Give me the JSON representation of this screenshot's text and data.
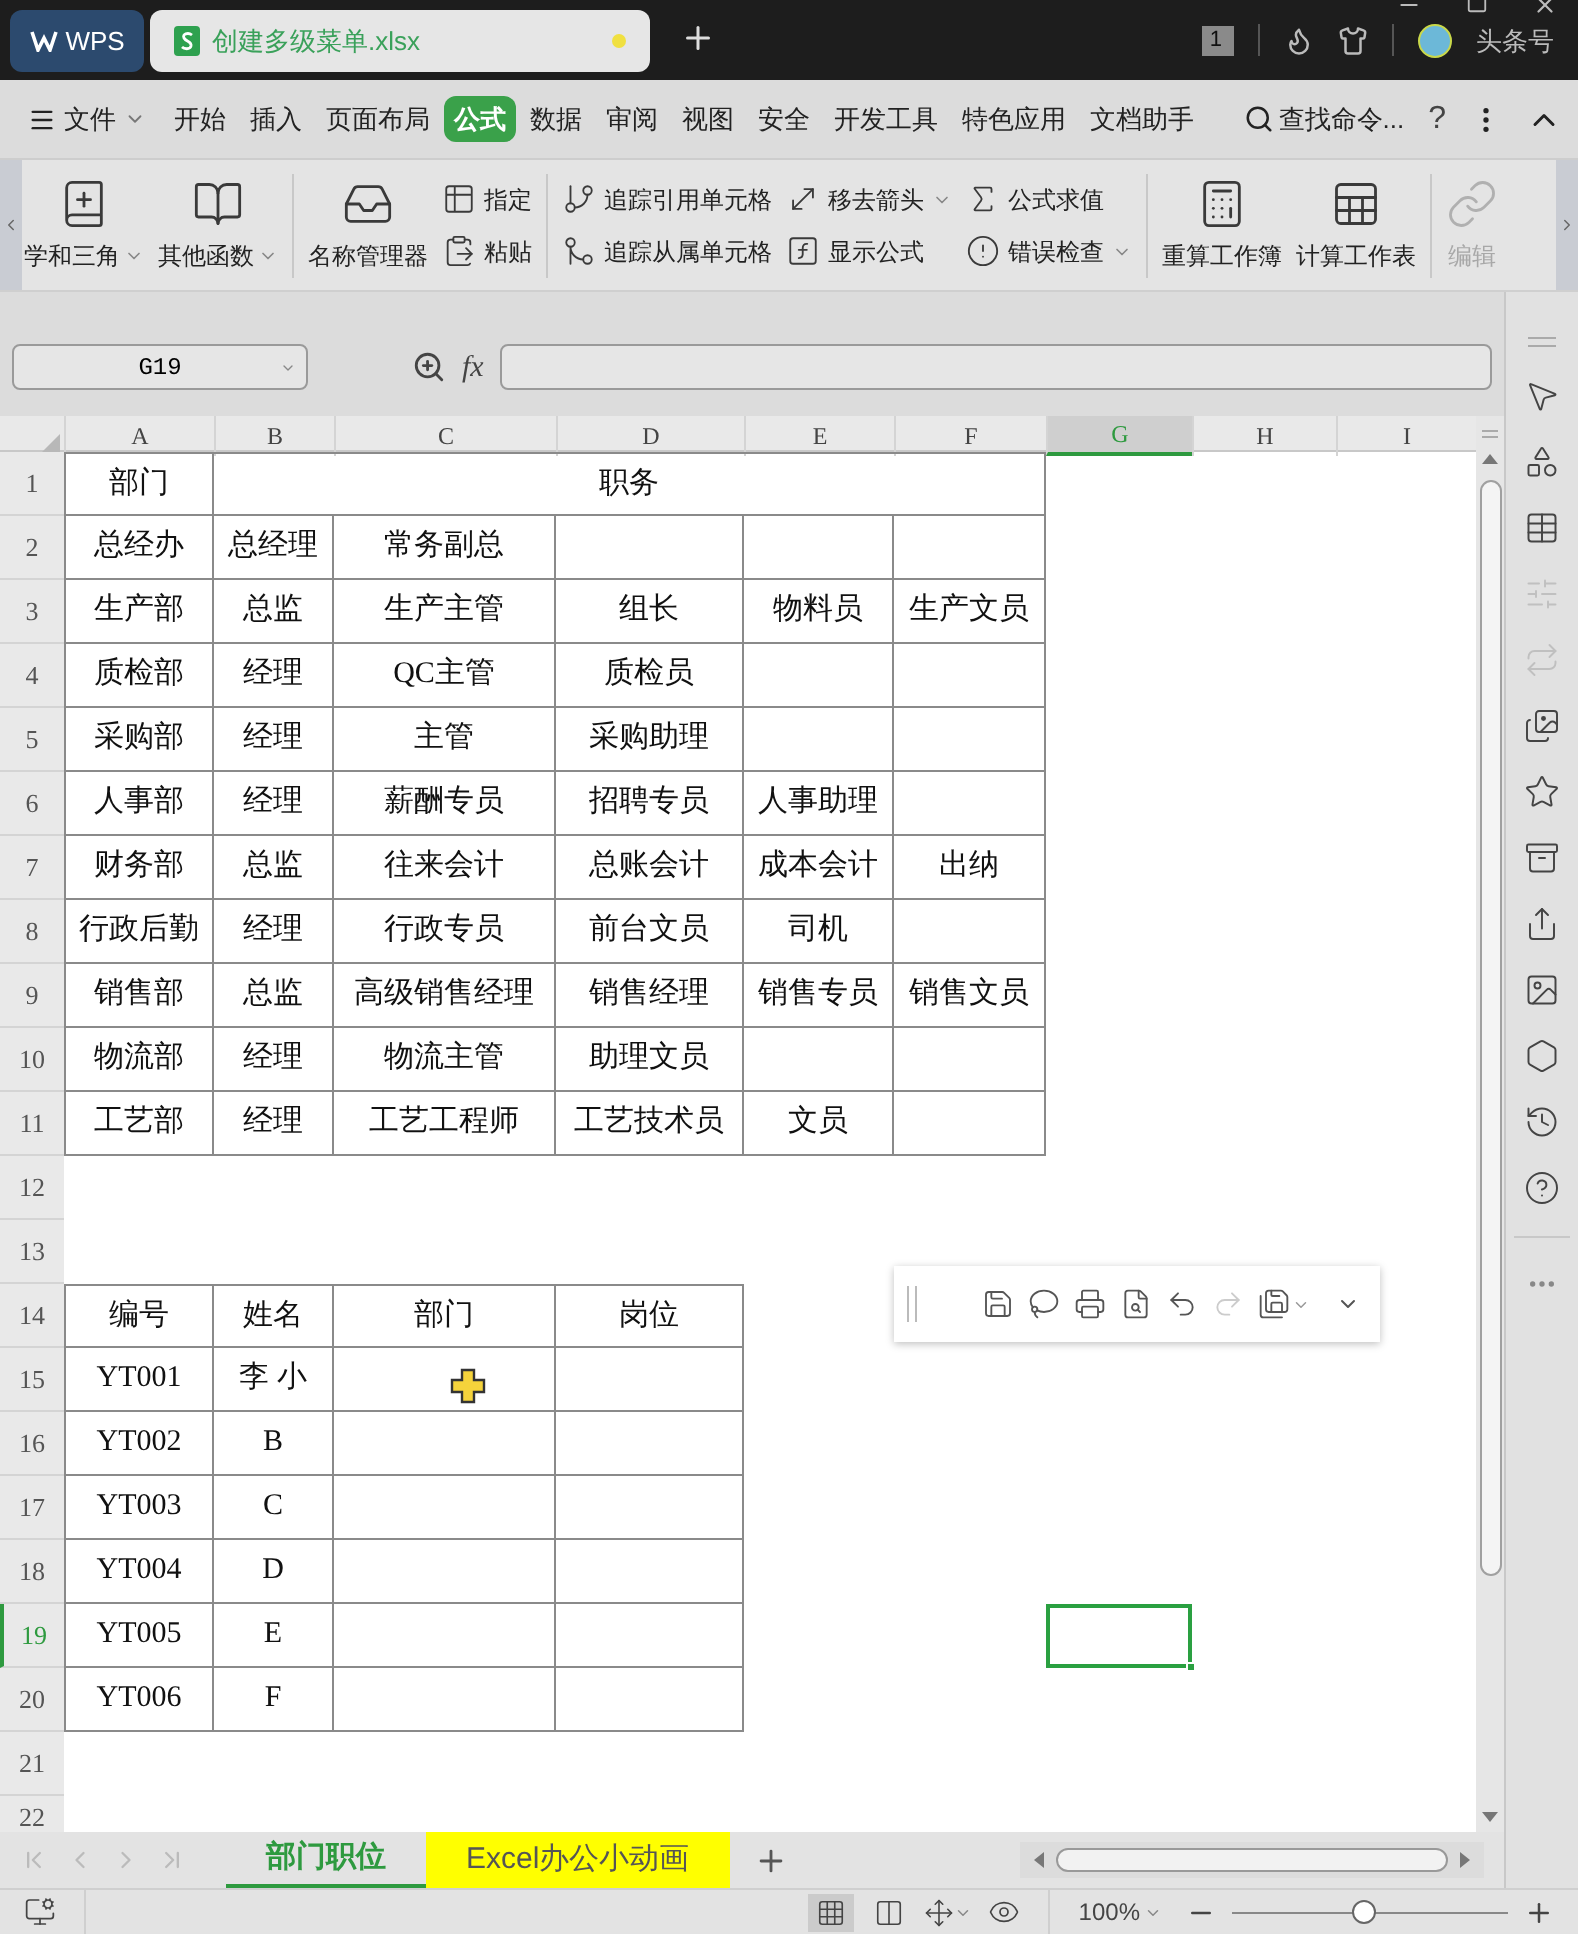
{
  "title_bar": {
    "app_tab": "WPS",
    "file_tab": "创建多级菜单.xlsx",
    "unsaved": true,
    "badge": "1",
    "account": "头条号"
  },
  "menu": {
    "file": "文件",
    "items": [
      {
        "label": "开始",
        "selected": false
      },
      {
        "label": "插入",
        "selected": false
      },
      {
        "label": "页面布局",
        "selected": false
      },
      {
        "label": "公式",
        "selected": true
      },
      {
        "label": "数据",
        "selected": false
      },
      {
        "label": "审阅",
        "selected": false
      },
      {
        "label": "视图",
        "selected": false
      },
      {
        "label": "安全",
        "selected": false
      },
      {
        "label": "开发工具",
        "selected": false
      },
      {
        "label": "特色应用",
        "selected": false
      },
      {
        "label": "文档助手",
        "selected": false
      }
    ],
    "search": "查找命令...",
    "help": "?"
  },
  "ribbon": [
    {
      "kind": "large",
      "label": "学和三角",
      "dropdown": true,
      "disabled": false
    },
    {
      "kind": "large",
      "label": "其他函数",
      "dropdown": true,
      "disabled": false
    },
    {
      "kind": "separator"
    },
    {
      "kind": "large",
      "label": "名称管理器",
      "dropdown": false,
      "disabled": false
    },
    {
      "kind": "stack",
      "items": [
        {
          "label": "指定",
          "dropdown": false
        },
        {
          "label": "粘贴",
          "dropdown": false
        }
      ]
    },
    {
      "kind": "separator"
    },
    {
      "kind": "stack",
      "items": [
        {
          "label": "追踪引用单元格",
          "dropdown": false
        },
        {
          "label": "追踪从属单元格",
          "dropdown": false
        }
      ]
    },
    {
      "kind": "stack",
      "items": [
        {
          "label": "移去箭头",
          "dropdown": true
        },
        {
          "label": "显示公式",
          "dropdown": false
        }
      ]
    },
    {
      "kind": "stack",
      "items": [
        {
          "label": "公式求值",
          "dropdown": false
        },
        {
          "label": "错误检查",
          "dropdown": true
        }
      ]
    },
    {
      "kind": "separator"
    },
    {
      "kind": "large",
      "label": "重算工作簿",
      "dropdown": false,
      "disabled": false
    },
    {
      "kind": "large",
      "label": "计算工作表",
      "dropdown": false,
      "disabled": false
    },
    {
      "kind": "separator"
    },
    {
      "kind": "large",
      "label": "编辑",
      "dropdown": false,
      "disabled": true
    }
  ],
  "formula_bar": {
    "name_box": "G19",
    "fx": "fx"
  },
  "sheet": {
    "columns": [
      {
        "label": "A",
        "selected": false
      },
      {
        "label": "B",
        "selected": false
      },
      {
        "label": "C",
        "selected": false
      },
      {
        "label": "D",
        "selected": false
      },
      {
        "label": "E",
        "selected": false
      },
      {
        "label": "F",
        "selected": false
      },
      {
        "label": "G",
        "selected": true
      },
      {
        "label": "H",
        "selected": false
      },
      {
        "label": "I",
        "selected": false
      }
    ],
    "rows": [
      {
        "label": "1",
        "selected": false,
        "cells": [
          {
            "text": "部门"
          },
          {
            "text": "职务",
            "kind": "merged"
          }
        ]
      },
      {
        "label": "2",
        "selected": false,
        "cells": [
          {
            "text": "总经办"
          },
          {
            "text": "总经理"
          },
          {
            "text": "常务副总"
          },
          {},
          {},
          {}
        ]
      },
      {
        "label": "3",
        "selected": false,
        "cells": [
          {
            "text": "生产部"
          },
          {
            "text": "总监"
          },
          {
            "text": "生产主管"
          },
          {
            "text": "组长"
          },
          {
            "text": "物料员"
          },
          {
            "text": "生产文员"
          }
        ]
      },
      {
        "label": "4",
        "selected": false,
        "cells": [
          {
            "text": "质检部"
          },
          {
            "text": "经理"
          },
          {
            "text": "QC主管"
          },
          {
            "text": "质检员"
          },
          {},
          {}
        ]
      },
      {
        "label": "5",
        "selected": false,
        "cells": [
          {
            "text": "采购部"
          },
          {
            "text": "经理"
          },
          {
            "text": "主管"
          },
          {
            "text": "采购助理"
          },
          {},
          {}
        ]
      },
      {
        "label": "6",
        "selected": false,
        "cells": [
          {
            "text": "人事部"
          },
          {
            "text": "经理"
          },
          {
            "text": "薪酬专员"
          },
          {
            "text": "招聘专员"
          },
          {
            "text": "人事助理"
          },
          {}
        ]
      },
      {
        "label": "7",
        "selected": false,
        "cells": [
          {
            "text": "财务部"
          },
          {
            "text": "总监"
          },
          {
            "text": "往来会计"
          },
          {
            "text": "总账会计"
          },
          {
            "text": "成本会计"
          },
          {
            "text": "出纳"
          }
        ]
      },
      {
        "label": "8",
        "selected": false,
        "cells": [
          {
            "text": "行政后勤"
          },
          {
            "text": "经理"
          },
          {
            "text": "行政专员"
          },
          {
            "text": "前台文员"
          },
          {
            "text": "司机"
          },
          {}
        ]
      },
      {
        "label": "9",
        "selected": false,
        "cells": [
          {
            "text": "销售部"
          },
          {
            "text": "总监"
          },
          {
            "text": "高级销售经理"
          },
          {
            "text": "销售经理"
          },
          {
            "text": "销售专员"
          },
          {
            "text": "销售文员"
          }
        ]
      },
      {
        "label": "10",
        "selected": false,
        "cells": [
          {
            "text": "物流部"
          },
          {
            "text": "经理"
          },
          {
            "text": "物流主管"
          },
          {
            "text": "助理文员"
          },
          {},
          {}
        ]
      },
      {
        "label": "11",
        "selected": false,
        "cells": [
          {
            "text": "工艺部"
          },
          {
            "text": "经理"
          },
          {
            "text": "工艺工程师"
          },
          {
            "text": "工艺技术员"
          },
          {
            "text": "文员"
          },
          {}
        ]
      },
      {
        "label": "12",
        "selected": false
      },
      {
        "label": "13",
        "selected": false
      },
      {
        "label": "14",
        "selected": false,
        "cells": [
          {
            "text": "编号"
          },
          {
            "text": "姓名"
          },
          {
            "text": "部门"
          },
          {
            "text": "岗位"
          }
        ]
      },
      {
        "label": "15",
        "selected": false,
        "cells": [
          {
            "text": "YT001"
          },
          {
            "text": "李 小"
          },
          {},
          {}
        ]
      },
      {
        "label": "16",
        "selected": false,
        "cells": [
          {
            "text": "YT002"
          },
          {
            "text": "B"
          },
          {},
          {}
        ]
      },
      {
        "label": "17",
        "selected": false,
        "cells": [
          {
            "text": "YT003"
          },
          {
            "text": "C"
          },
          {},
          {}
        ]
      },
      {
        "label": "18",
        "selected": false,
        "cells": [
          {
            "text": "YT004"
          },
          {
            "text": "D"
          },
          {},
          {}
        ]
      },
      {
        "label": "19",
        "selected": true,
        "cells": [
          {
            "text": "YT005"
          },
          {
            "text": "E"
          },
          {},
          {}
        ]
      },
      {
        "label": "20",
        "selected": false,
        "cells": [
          {
            "text": "YT006"
          },
          {
            "text": "F"
          },
          {},
          {}
        ]
      },
      {
        "label": "21",
        "selected": false
      },
      {
        "label": "22",
        "selected": false
      }
    ]
  },
  "sheet_tabs": [
    {
      "label": "部门职位",
      "selected": true,
      "color": "#e3e3e3"
    },
    {
      "label": "Excel办公小动画",
      "selected": false,
      "color": "#ffff00"
    }
  ],
  "status_bar": {
    "zoom": {
      "label": "100%",
      "level": 0.48
    }
  }
}
